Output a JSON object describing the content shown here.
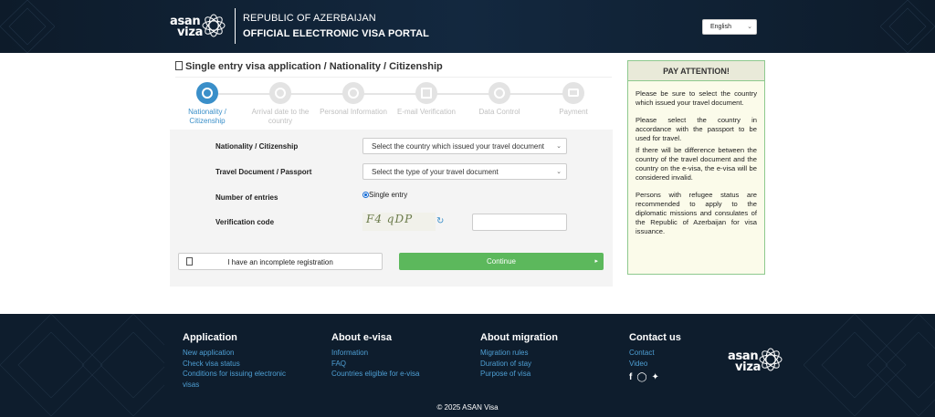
{
  "header": {
    "logo_line1": "asan",
    "logo_line2": "viza",
    "title_line1": "REPUBLIC OF AZERBAIJAN",
    "title_line2": "OFFICIAL ELECTRONIC VISA PORTAL",
    "language": "English"
  },
  "page": {
    "title": "Single entry visa application / Nationality / Citizenship"
  },
  "steps": [
    {
      "label": "Nationality / Citizenship",
      "icon": "globe-icon",
      "active": true
    },
    {
      "label": "Arrival date to the country",
      "icon": "clock-icon",
      "active": false
    },
    {
      "label": "Personal Information",
      "icon": "person-icon",
      "active": false
    },
    {
      "label": "E-mail Verification",
      "icon": "envelope-icon",
      "active": false
    },
    {
      "label": "Data Control",
      "icon": "check-icon",
      "active": false
    },
    {
      "label": "Payment",
      "icon": "card-icon",
      "active": false
    }
  ],
  "form": {
    "nationality_label": "Nationality / Citizenship",
    "nationality_placeholder": "Select the country which issued your travel document",
    "document_label": "Travel Document / Passport",
    "document_placeholder": "Select the type of your travel document",
    "entries_label": "Number of entries",
    "entries_value": "Single entry",
    "verification_label": "Verification code",
    "captcha_text": "F4 qDP",
    "incomplete_button": "I have an incomplete registration",
    "continue_button": "Continue"
  },
  "attention": {
    "title": "PAY ATTENTION!",
    "p1": "Please be sure to select the country which issued your travel document.",
    "p2": "Please select the country in accordance with the passport to be used for travel.",
    "p3": "If there will be difference between the country of the travel document and the country on the e-visa, the e-visa will be considered invalid.",
    "p4": "Persons with refugee status are recommended to apply to the diplomatic missions and consulates of the Republic of Azerbaijan for visa issuance."
  },
  "footer": {
    "columns": [
      {
        "heading": "Application",
        "links": [
          "New application",
          "Check visa status",
          "Conditions for issuing electronic visas"
        ]
      },
      {
        "heading": "About e-visa",
        "links": [
          "Information",
          "FAQ",
          "Countries eligible for e-visa"
        ]
      },
      {
        "heading": "About migration",
        "links": [
          "Migration rules",
          "Duration of stay",
          "Purpose of visa"
        ]
      },
      {
        "heading": "Contact us",
        "links": [
          "Contact",
          "Video"
        ]
      }
    ],
    "logo_line1": "asan",
    "logo_line2": "viza",
    "copyright": "© 2025 ASAN Visa"
  },
  "colors": {
    "header_bg": "#0d1b2a",
    "accent": "#3a8fc9",
    "continue": "#5cb85c",
    "link": "#4e9fd4"
  }
}
